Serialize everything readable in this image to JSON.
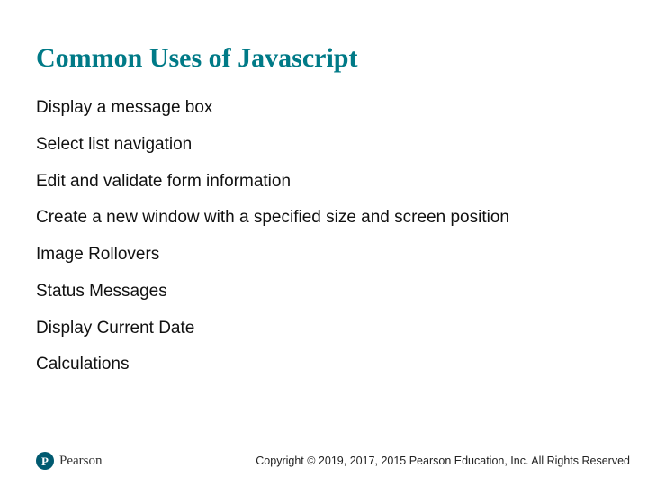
{
  "title": "Common Uses of Javascript",
  "items": [
    "Display a message box",
    "Select list navigation",
    "Edit and validate form information",
    "Create a new window with a specified size and screen position",
    "Image Rollovers",
    "Status Messages",
    "Display Current Date",
    "Calculations"
  ],
  "brand": {
    "badge_letter": "P",
    "name": "Pearson"
  },
  "copyright": "Copyright © 2019, 2017, 2015 Pearson Education, Inc. All Rights Reserved"
}
